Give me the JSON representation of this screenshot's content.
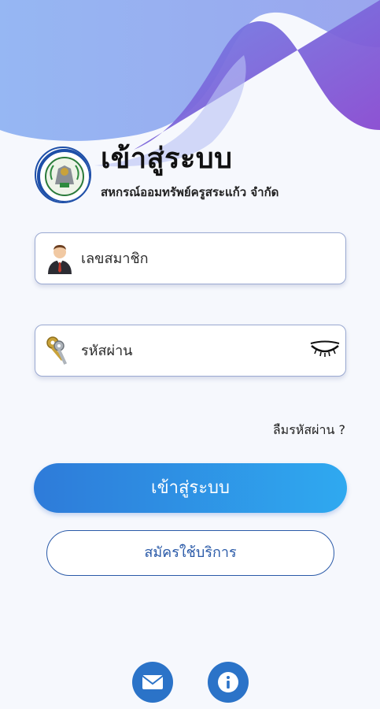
{
  "colors": {
    "wave_light": "#8fb3f2",
    "wave_mid": "#7f8de8",
    "wave_dark": "#8249d0",
    "primary_gradient_start": "#2e7bd9",
    "primary_gradient_end": "#2fa9f0",
    "outline_blue": "#2a5aa8",
    "round_button": "#2b73c8"
  },
  "header": {
    "title": "เข้าสู่ระบบ",
    "subtitle": "สหกรณ์ออมทรัพย์ครูสระแก้ว จำกัด"
  },
  "form": {
    "member_id": {
      "placeholder": "เลขสมาชิก",
      "icon": "user-icon"
    },
    "password": {
      "placeholder": "รหัสผ่าน",
      "icon": "key-icon",
      "toggle_icon": "eye-closed-icon"
    },
    "forgot_label": "ลืมรหัสผ่าน ?"
  },
  "actions": {
    "login_label": "เข้าสู่ระบบ",
    "register_label": "สมัครใช้บริการ"
  },
  "footer": {
    "icons": [
      "mail-icon",
      "info-icon"
    ]
  }
}
